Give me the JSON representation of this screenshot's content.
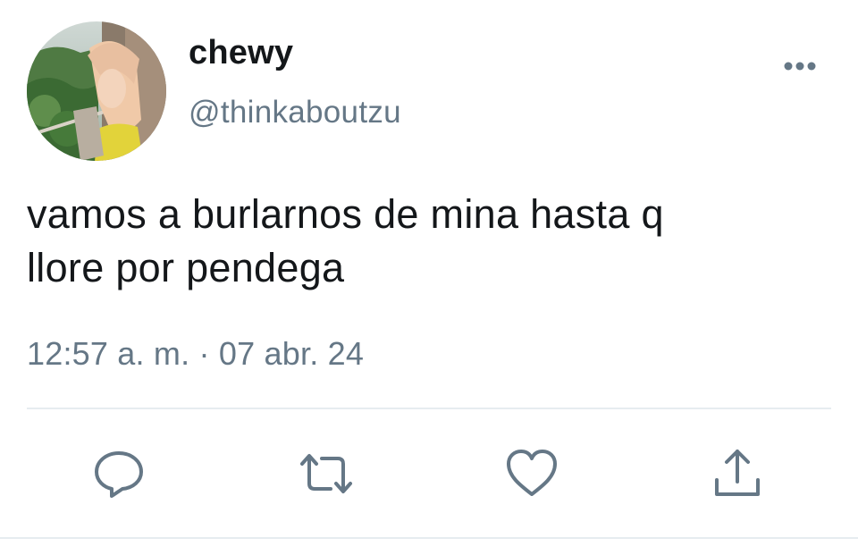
{
  "tweet": {
    "author": {
      "display_name": "chewy",
      "handle": "@thinkaboutzu"
    },
    "text": "vamos a burlarnos de mina hasta q\nllore por pendega",
    "time": "12:57 a. m.",
    "separator": " · ",
    "date": "07 abr. 24"
  },
  "icons": {
    "more": "more-dots-icon",
    "reply": "reply-bubble-icon",
    "retweet": "retweet-icon",
    "like": "heart-icon",
    "share": "share-upload-icon"
  },
  "colors": {
    "text_primary": "#14171a",
    "text_secondary": "#657786",
    "icon": "#657786",
    "divider": "#e6ecf0"
  }
}
